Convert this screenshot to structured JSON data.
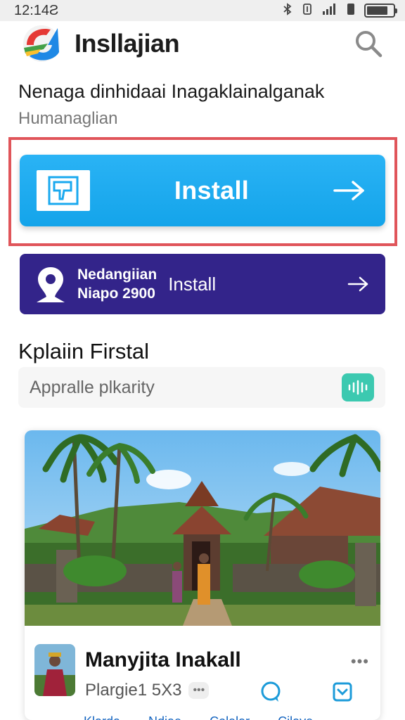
{
  "status_bar": {
    "time": "12:14Ƨ"
  },
  "header": {
    "title": "Insllajian",
    "logo_icon": "app-logo-icon",
    "search_icon": "search-icon"
  },
  "headline": "Nenaga dinhidaai Inagaklainalganak",
  "subline": "Humanaglian",
  "primary_install": {
    "label": "Install",
    "icon": "app-icon",
    "arrow_icon": "arrow-right-icon",
    "color": "#1aa9ef"
  },
  "secondary_install": {
    "line1": "Nedangiian",
    "line2": "Niapo 2900",
    "label": "Install",
    "icon": "location-pin-icon",
    "arrow_icon": "arrow-right-icon",
    "color": "#33248a"
  },
  "section": {
    "title": "Kplaiin Firstal",
    "search_placeholder": "Appralle plkarity",
    "voice_icon": "waveform-icon"
  },
  "card": {
    "title": "Manyjita Inakall",
    "meta": "Plargie1 5X3",
    "badge": "•••",
    "more": "•••",
    "tabs": [
      "Klarda",
      "Ndiae",
      "Colalar",
      "Cilave"
    ]
  }
}
